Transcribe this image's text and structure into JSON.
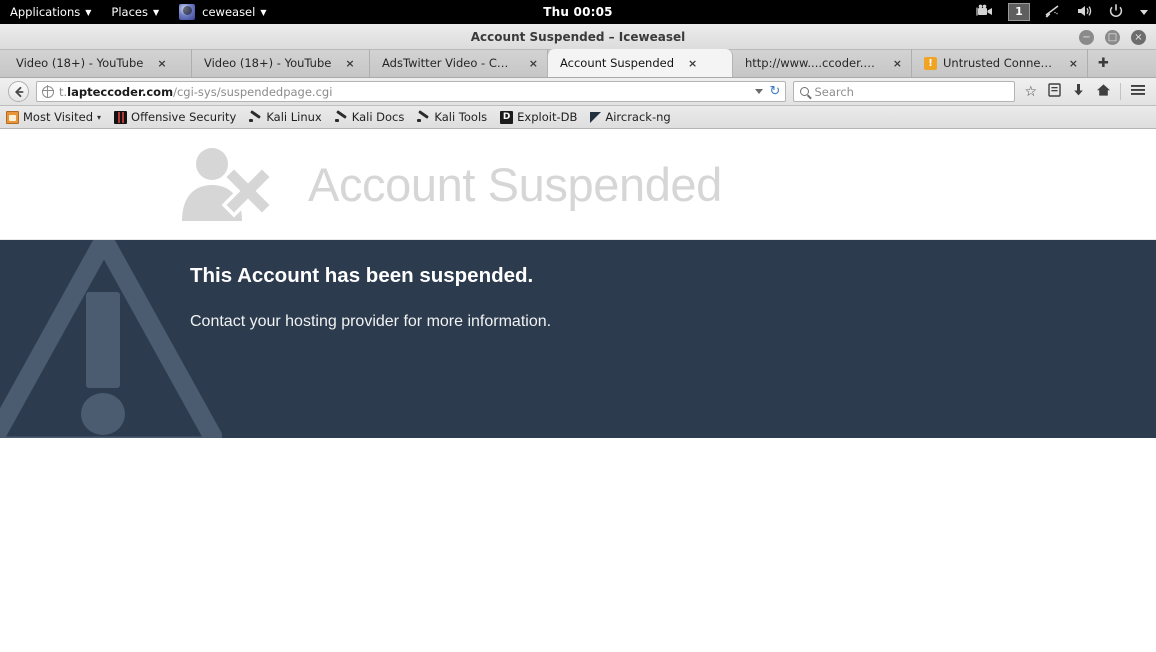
{
  "system_bar": {
    "applications_label": "Applications",
    "places_label": "Places",
    "app_label": "ceweasel",
    "clock": "Thu 00:05",
    "workspace": "1",
    "icons": [
      "video-recorder-icon",
      "workspace-indicator",
      "network-icon",
      "volume-icon",
      "power-icon",
      "dropdown-caret-icon"
    ]
  },
  "window": {
    "title": "Account Suspended – Iceweasel",
    "minimize_label": "−",
    "maximize_label": "□",
    "close_label": "×"
  },
  "tabs": [
    {
      "label": "Video (18+) - YouTube",
      "close": "×",
      "active": false,
      "favicon": "none"
    },
    {
      "label": "Video (18+) - YouTube",
      "close": "×",
      "active": false,
      "favicon": "none"
    },
    {
      "label": "AdsTwitter Video - Chro...",
      "close": "×",
      "active": false,
      "favicon": "none"
    },
    {
      "label": "Account Suspended",
      "close": "×",
      "active": true,
      "favicon": "none"
    },
    {
      "label": "http://www....ccoder.com/",
      "close": "×",
      "active": false,
      "favicon": "none"
    },
    {
      "label": "Untrusted Connection",
      "close": "×",
      "active": false,
      "favicon": "warn"
    }
  ],
  "new_tab_label": "✚",
  "navbar": {
    "back_label": "←",
    "url_prefix": "t.",
    "url_domain": "lapteccoder.com",
    "url_path": "/cgi-sys/suspendedpage.cgi",
    "url_full": "t.lapteccoder.com/cgi-sys/suspendedpage.cgi",
    "reload_label": "↻",
    "search_placeholder": "Search",
    "bookmark_star": "☆",
    "library_icon": "▤",
    "download_icon": "⬇",
    "home_icon": "⌂",
    "menu_icon": "☰"
  },
  "bookmarks": [
    {
      "label": "Most Visited",
      "icon": "most",
      "caret": "▾"
    },
    {
      "label": "Offensive Security",
      "icon": "offsec",
      "caret": ""
    },
    {
      "label": "Kali Linux",
      "icon": "dragon",
      "caret": ""
    },
    {
      "label": "Kali Docs",
      "icon": "dragon",
      "caret": ""
    },
    {
      "label": "Kali Tools",
      "icon": "dragon",
      "caret": ""
    },
    {
      "label": "Exploit-DB",
      "icon": "exploit",
      "caret": ""
    },
    {
      "label": "Aircrack-ng",
      "icon": "aircrack",
      "caret": ""
    }
  ],
  "page": {
    "header_title": "Account Suspended",
    "heading": "This Account has been suspended.",
    "body": "Contact your hosting provider for more information.",
    "colors": {
      "panel_background": "#2c3b4d",
      "watermark": "#4b5c70",
      "header_gray": "#d6d6d6",
      "heading_text": "#ffffff"
    }
  }
}
